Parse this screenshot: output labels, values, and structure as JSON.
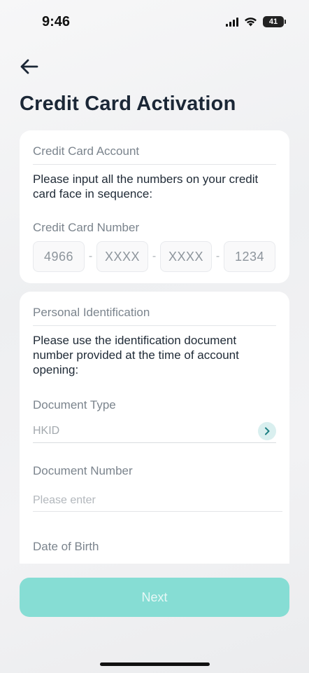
{
  "status_bar": {
    "time": "9:46",
    "battery": "41"
  },
  "page": {
    "title": "Credit Card Activation"
  },
  "credit_card_section": {
    "header": "Credit Card Account",
    "instruction": "Please input all the numbers on your credit card face in sequence:",
    "number_label": "Credit Card Number",
    "number_segments": [
      "4966",
      "XXXX",
      "XXXX",
      "1234"
    ],
    "separator": "-"
  },
  "identification_section": {
    "header": "Personal Identification",
    "instruction": "Please use the identification document number provided at the time of account opening:",
    "document_type_label": "Document Type",
    "document_type_value": "HKID",
    "document_number_label": "Document Number",
    "document_number_placeholder": "Please enter",
    "dob_label": "Date of Birth"
  },
  "actions": {
    "next_label": "Next"
  },
  "colors": {
    "accent": "#86ddd4",
    "title": "#1b2736",
    "muted": "#7b848d"
  },
  "icons": {
    "back": "arrow-left-icon",
    "select": "chevron-right-icon"
  }
}
